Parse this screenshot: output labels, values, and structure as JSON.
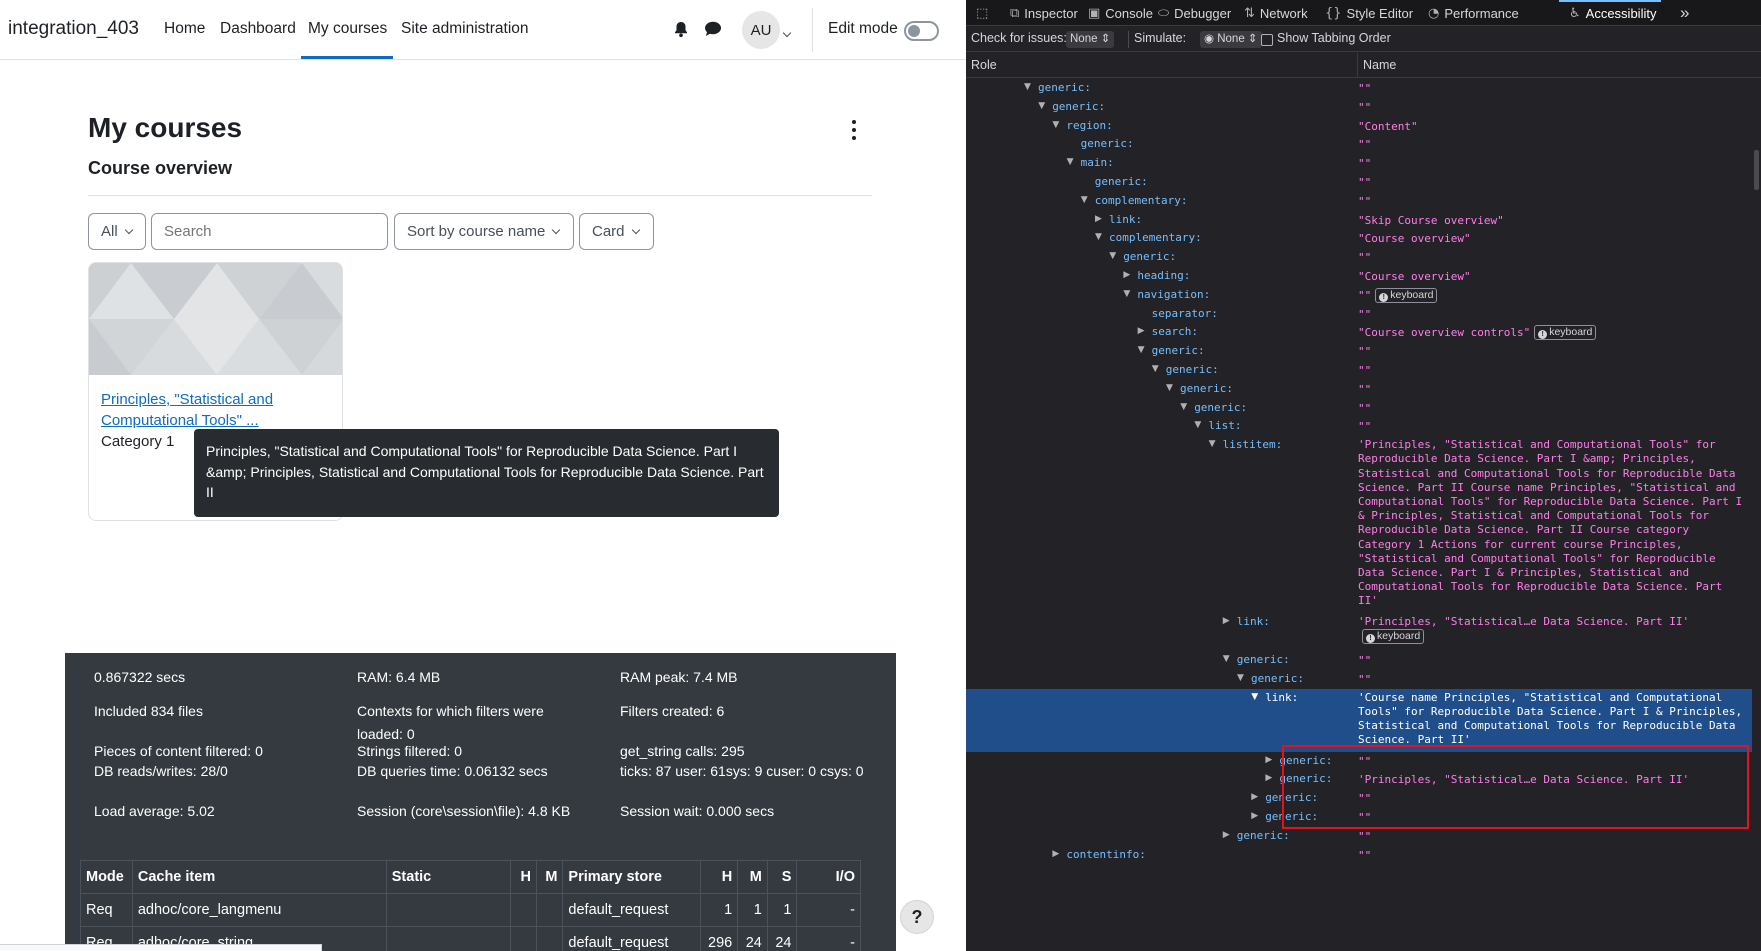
{
  "moodle": {
    "site_name": "integration_403",
    "nav": {
      "home": "Home",
      "dashboard": "Dashboard",
      "my_courses": "My courses",
      "site_admin": "Site administration"
    },
    "avatar_initials": "AU",
    "edit_mode_label": "Edit mode",
    "page_title": "My courses",
    "section_title": "Course overview",
    "filters": {
      "grouping": "All",
      "search_placeholder": "Search",
      "sort": "Sort by course name",
      "view": "Card"
    },
    "course_card": {
      "link_text": "Principles, \"Statistical and Computational Tools\" ...",
      "category": "Category 1"
    },
    "tooltip": " Principles, \"Statistical and Computational Tools\" for Reproducible Data Science. Part I &amp; Principles, Statistical and Computational Tools for Reproducible Data Science. Part II",
    "perf": {
      "items": [
        "0.867322 secs",
        "RAM: 6.4 MB",
        "RAM peak: 7.4 MB",
        "Included 834 files",
        "Contexts for which filters were loaded: 0",
        "Filters created: 6",
        "Pieces of content filtered: 0",
        "Strings filtered: 0",
        "get_string calls: 295",
        "DB reads/writes: 28/0",
        "DB queries time: 0.06132 secs",
        "ticks: 87 user: 61sys: 9 cuser: 0 csys: 0",
        "Load average: 5.02",
        "Session (core\\session\\file): 4.8 KB",
        "Session wait: 0.000 secs"
      ],
      "table_headers": [
        "Mode",
        "Cache item",
        "Static",
        "H",
        "M",
        "Primary store",
        "H",
        "M",
        "S",
        "I/O"
      ],
      "rows": [
        [
          "Req",
          "adhoc/core_langmenu",
          "",
          "",
          "",
          "default_request",
          "1",
          "1",
          "1",
          "-"
        ],
        [
          "Req",
          "adhoc/core_string",
          "",
          "",
          "",
          "default_request",
          "296",
          "24",
          "24",
          "-"
        ]
      ]
    },
    "help": "?"
  },
  "devtools": {
    "tabs": [
      "Inspector",
      "Console",
      "Debugger",
      "Network",
      "Style Editor",
      "Performance",
      "Accessibility"
    ],
    "tab_icons": {
      "Inspector": "⧉",
      "Console": "▣",
      "Debugger": "⬭",
      "Network": "⇅",
      "Style Editor": "{}",
      "Performance": "◔",
      "Accessibility": "♿"
    },
    "more": "»",
    "filter_bar": {
      "check_label": "Check for issues:",
      "check_value": "None",
      "simulate_label": "Simulate:",
      "simulate_value": "None",
      "tabbing": "Show Tabbing Order"
    },
    "columns": {
      "role": "Role",
      "name": "Name"
    },
    "keyboard_badge": "keyboard",
    "tree": [
      {
        "role": "generic:",
        "name": "\"\"",
        "depth": 0,
        "tw": "down"
      },
      {
        "role": "generic:",
        "name": "\"\"",
        "depth": 1,
        "tw": "down"
      },
      {
        "role": "region:",
        "name": "\"Content\"",
        "depth": 2,
        "tw": "down"
      },
      {
        "role": "generic:",
        "name": "\"\"",
        "depth": 3,
        "tw": ""
      },
      {
        "role": "main:",
        "name": "\"\"",
        "depth": 3,
        "tw": "down"
      },
      {
        "role": "generic:",
        "name": "\"\"",
        "depth": 4,
        "tw": ""
      },
      {
        "role": "complementary:",
        "name": "\"\"",
        "depth": 4,
        "tw": "down"
      },
      {
        "role": "link:",
        "name": "\"Skip Course overview\"",
        "depth": 5,
        "tw": "right"
      },
      {
        "role": "complementary:",
        "name": "\"Course overview\"",
        "depth": 5,
        "tw": "down"
      },
      {
        "role": "generic:",
        "name": "\"\"",
        "depth": 6,
        "tw": "down"
      },
      {
        "role": "heading:",
        "name": "\"Course overview\"",
        "depth": 7,
        "tw": "right"
      },
      {
        "role": "navigation:",
        "name": "\"\"",
        "depth": 7,
        "tw": "down",
        "kb": true
      },
      {
        "role": "separator:",
        "name": "\"\"",
        "depth": 8,
        "tw": ""
      },
      {
        "role": "search:",
        "name": "\"Course overview controls\"",
        "depth": 8,
        "tw": "right",
        "kb": true
      },
      {
        "role": "generic:",
        "name": "\"\"",
        "depth": 8,
        "tw": "down"
      },
      {
        "role": "generic:",
        "name": "\"\"",
        "depth": 9,
        "tw": "down"
      },
      {
        "role": "generic:",
        "name": "\"\"",
        "depth": 10,
        "tw": "down"
      },
      {
        "role": "generic:",
        "name": "\"\"",
        "depth": 11,
        "tw": "down"
      },
      {
        "role": "list:",
        "name": "\"\"",
        "depth": 12,
        "tw": "down"
      },
      {
        "role": "listitem:",
        "name": "'Principles, \"Statistical and Computational Tools\" for Reproducible Data Science. Part I &amp; Principles, Statistical and Computational Tools for Reproducible Data Science. Part II Course name Principles, \"Statistical and Computational Tools\" for Reproducible Data Science. Part I & Principles, Statistical and Computational Tools for Reproducible Data Science. Part II Course category Category 1 Actions for current course Principles, \"Statistical and Computational Tools\" for Reproducible Data Science. Part I & Principles, Statistical and Computational Tools for Reproducible Data Science. Part II'",
        "depth": 13,
        "tw": "down",
        "lines": 12
      },
      {
        "role": "link:",
        "name": "'Principles, \"Statistical…e Data Science. Part II'",
        "depth": 14,
        "tw": "right",
        "kb_below": true,
        "lines": 2
      },
      {
        "role": "generic:",
        "name": "\"\"",
        "depth": 14,
        "tw": "down"
      },
      {
        "role": "generic:",
        "name": "\"\"",
        "depth": 15,
        "tw": "down"
      },
      {
        "role": "link:",
        "name": "'Course name Principles, \"Statistical and Computational Tools\" for Reproducible Data Science. Part I & Principles, Statistical and Computational Tools for Reproducible Data Science. Part II'",
        "depth": 16,
        "tw": "down",
        "lines": 4,
        "selected": true
      },
      {
        "role": "generic:",
        "name": "\"\"",
        "depth": 17,
        "tw": "right"
      },
      {
        "role": "generic:",
        "name": "'Principles, \"Statistical…e Data Science. Part II'",
        "depth": 17,
        "tw": "right"
      },
      {
        "role": "generic:",
        "name": "\"\"",
        "depth": 16,
        "tw": "right"
      },
      {
        "role": "generic:",
        "name": "\"\"",
        "depth": 16,
        "tw": "right"
      },
      {
        "role": "generic:",
        "name": "\"\"",
        "depth": 14,
        "tw": "right"
      },
      {
        "role": "contentinfo:",
        "name": "\"\"",
        "depth": 2,
        "tw": "right"
      }
    ]
  }
}
